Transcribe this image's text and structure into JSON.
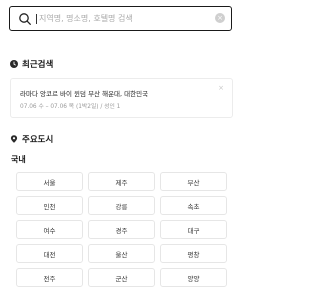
{
  "search": {
    "placeholder": "지역명, 명소명, 호텔명 검색",
    "clear_symbol": "×"
  },
  "recent": {
    "heading": "최근검색",
    "items": [
      {
        "title": "라마다 앙코르 바이 윈덤 부산 해운대, 대한민국",
        "details": "07.06 수 – 07.06 목 (1박2일) / 성인 1",
        "remove_symbol": "×"
      }
    ]
  },
  "popular": {
    "heading": "주요도시",
    "domestic_label": "국내",
    "cities": [
      "서울",
      "제주",
      "부산",
      "인천",
      "강릉",
      "속초",
      "여수",
      "경주",
      "대구",
      "대전",
      "울산",
      "평창",
      "전주",
      "군산",
      "양양"
    ]
  }
}
